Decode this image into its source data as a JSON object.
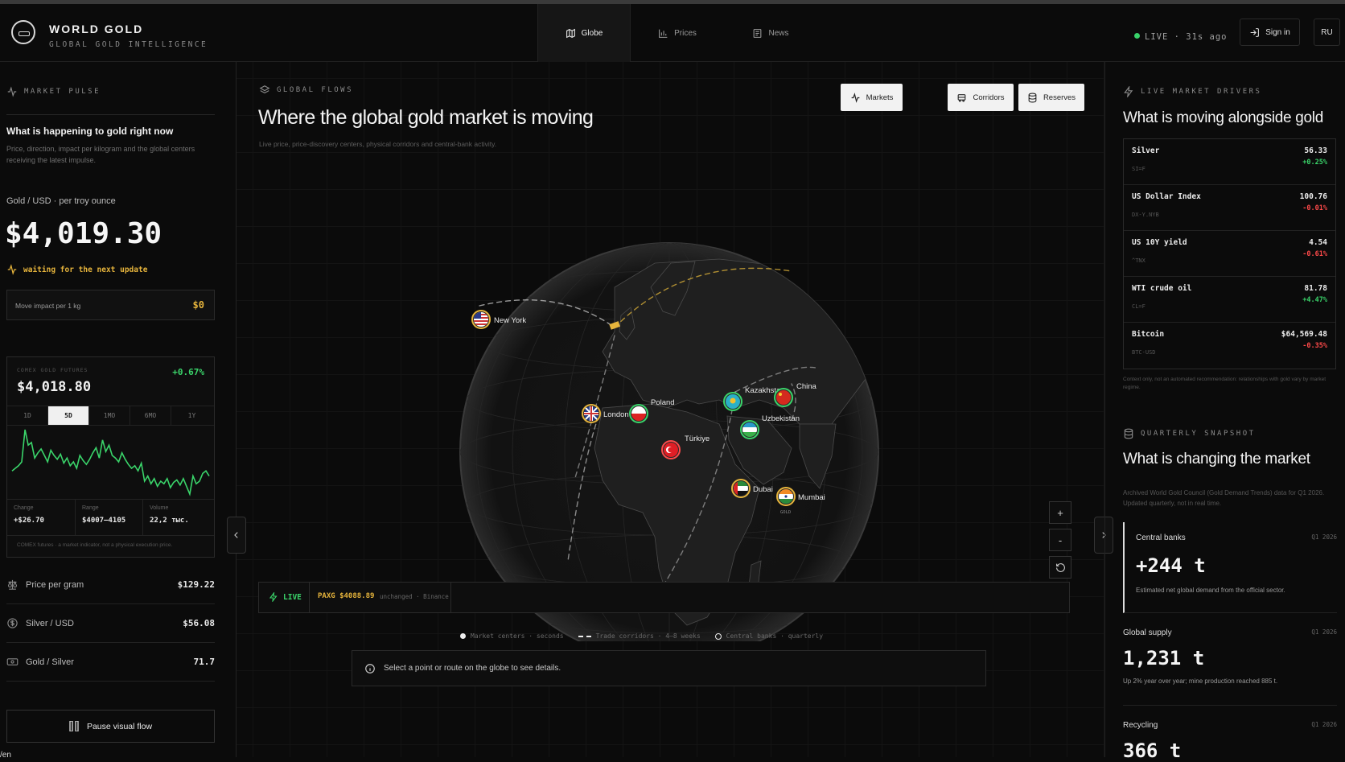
{
  "brand": {
    "title": "WORLD GOLD",
    "subtitle": "GLOBAL GOLD INTELLIGENCE"
  },
  "nav": {
    "tabs": [
      {
        "label": "Globe",
        "icon": "map-icon",
        "active": true
      },
      {
        "label": "Prices",
        "icon": "bar-chart-icon",
        "active": false
      },
      {
        "label": "News",
        "icon": "newspaper-icon",
        "active": false
      }
    ],
    "live_status": "LIVE · 31s ago",
    "sign_in": "Sign in",
    "language": "RU"
  },
  "left": {
    "section_label": "MARKET PULSE",
    "heading": "What is happening to gold right now",
    "description": "Price, direction, impact per kilogram and the global centers receiving the latest impulse.",
    "price_caption": "Gold / USD · per troy ounce",
    "price": "$4,019.30",
    "waiting": "waiting for the next update",
    "move_impact_label": "Move impact per 1 kg",
    "move_impact_value": "$0",
    "futures": {
      "label": "COMEX GOLD FUTURES",
      "price": "$4,018.80",
      "change": "+0.67%",
      "timeframes": [
        "1D",
        "5D",
        "1MO",
        "6MO",
        "1Y"
      ],
      "active_timeframe": "5D",
      "stats": [
        {
          "label": "Change",
          "value": "+$26.70"
        },
        {
          "label": "Range",
          "value": "$4007–4105"
        },
        {
          "label": "Volume",
          "value": "22,2 тыс."
        }
      ],
      "note": "COMEX futures · a market indicator, not a physical execution price.",
      "sparkline": [
        62,
        60,
        58,
        55,
        30,
        42,
        40,
        52,
        48,
        45,
        50,
        55,
        46,
        50,
        53,
        49,
        56,
        52,
        58,
        55,
        60,
        50,
        54,
        57,
        53,
        48,
        44,
        52,
        38,
        47,
        42,
        50,
        52,
        55,
        48,
        53,
        57,
        60,
        58,
        62,
        56,
        70,
        66,
        72,
        68,
        74,
        70,
        72,
        68,
        75,
        71,
        69,
        73,
        68,
        74,
        80,
        66,
        72,
        70,
        64,
        62,
        66
      ]
    },
    "rows": [
      {
        "icon": "scale-icon",
        "label": "Price per gram",
        "value": "$129.22"
      },
      {
        "icon": "dollar-circle-icon",
        "label": "Silver / USD",
        "value": "$56.08"
      },
      {
        "icon": "banknote-icon",
        "label": "Gold / Silver",
        "value": "71.7"
      }
    ],
    "pause_button": "Pause visual flow",
    "footer_fragment": "/en"
  },
  "center": {
    "section_label": "GLOBAL FLOWS",
    "title": "Where the global gold market is moving",
    "subtitle": "Live price, price-discovery centers, physical corridors and central-bank activity.",
    "layer_buttons": [
      {
        "label": "Markets",
        "icon": "activity-icon"
      },
      {
        "label": "Corridors",
        "icon": "truck-icon"
      },
      {
        "label": "Reserves",
        "icon": "database-icon"
      }
    ],
    "cities": [
      {
        "name": "New York",
        "flag": "flag-us"
      },
      {
        "name": "London",
        "flag": "flag-uk"
      },
      {
        "name": "Poland",
        "flag": "flag-pl"
      },
      {
        "name": "Kazakhstan",
        "flag": "flag-kz"
      },
      {
        "name": "China",
        "flag": "flag-cn"
      },
      {
        "name": "Uzbekistan",
        "flag": "flag-uz"
      },
      {
        "name": "Türkiye",
        "flag": "flag-tr"
      },
      {
        "name": "Dubai",
        "flag": "flag-ae"
      },
      {
        "name": "Mumbai",
        "flag": "flag-in"
      }
    ],
    "mumbai_tag": "GOLD",
    "zoom_in": "+",
    "zoom_out": "-",
    "ticker": {
      "live_label": "LIVE",
      "symbol_price": "PAXG $4088.89",
      "detail": "unchanged · Binance"
    },
    "legend": [
      {
        "marker": "dot",
        "label": "Market centers · seconds"
      },
      {
        "marker": "dash",
        "label": "Trade corridors · 4–8 weeks"
      },
      {
        "marker": "ring",
        "label": "Central banks · quarterly"
      }
    ],
    "info_text": "Select a point or route on the globe to see details."
  },
  "right": {
    "drivers_label": "LIVE MARKET DRIVERS",
    "drivers_heading": "What is moving alongside gold",
    "markets": [
      {
        "name": "Silver",
        "symbol": "SI=F",
        "value": "56.33",
        "change": "+0.25%",
        "dir": "up"
      },
      {
        "name": "US Dollar Index",
        "symbol": "DX-Y.NYB",
        "value": "100.76",
        "change": "-0.01%",
        "dir": "down"
      },
      {
        "name": "US 10Y yield",
        "symbol": "^TNX",
        "value": "4.54",
        "change": "-0.61%",
        "dir": "down"
      },
      {
        "name": "WTI crude oil",
        "symbol": "CL=F",
        "value": "81.78",
        "change": "+4.47%",
        "dir": "up"
      },
      {
        "name": "Bitcoin",
        "symbol": "BTC-USD",
        "value": "$64,569.48",
        "change": "-0.35%",
        "dir": "down"
      }
    ],
    "drivers_note": "Context only, not an automated recommendation: relationships with gold vary by market regime.",
    "snapshot_label": "QUARTERLY SNAPSHOT",
    "snapshot_heading": "What is changing the market",
    "snapshot_desc": "Archived World Gold Council (Gold Demand Trends) data for Q1 2026. Updated quarterly, not in real time.",
    "cards": [
      {
        "title": "Central banks",
        "period": "Q1 2026",
        "value": "+244 t",
        "note": "Estimated net global demand from the official sector."
      },
      {
        "title": "Global supply",
        "period": "Q1 2026",
        "value": "1,231 t",
        "note": "Up 2% year over year; mine production reached 885 t."
      },
      {
        "title": "Recycling",
        "period": "Q1 2026",
        "value": "366 t",
        "note": ""
      }
    ]
  }
}
